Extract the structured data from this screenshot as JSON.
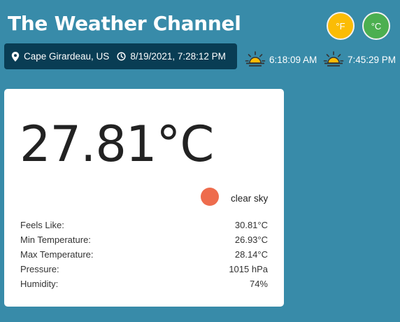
{
  "header": {
    "title": "The Weather Channel"
  },
  "units": {
    "fahrenheit": "°F",
    "celsius": "°C"
  },
  "location": {
    "place": "Cape Girardeau, US",
    "datetime": "8/19/2021, 7:28:12 PM"
  },
  "sun": {
    "sunrise": "6:18:09 AM",
    "sunset": "7:45:29 PM"
  },
  "current": {
    "temperature": "27.81°C",
    "condition": "clear sky",
    "condition_color": "#ee6c4d"
  },
  "stats": [
    {
      "label": "Feels Like:",
      "value": "30.81°C"
    },
    {
      "label": "Min Temperature:",
      "value": "26.93°C"
    },
    {
      "label": "Max Temperature:",
      "value": "28.14°C"
    },
    {
      "label": "Pressure:",
      "value": "1015 hPa"
    },
    {
      "label": "Humidity:",
      "value": "74%"
    }
  ],
  "colors": {
    "background": "#388ba9",
    "location_bar": "#093d54",
    "fahrenheit_button": "#fbbc05",
    "celsius_button": "#4caf50"
  },
  "icons": {
    "location": "map-pin-icon",
    "time": "clock-icon",
    "sunrise": "sunrise-icon",
    "sunset": "sunset-icon",
    "condition": "weather-condition-icon"
  }
}
